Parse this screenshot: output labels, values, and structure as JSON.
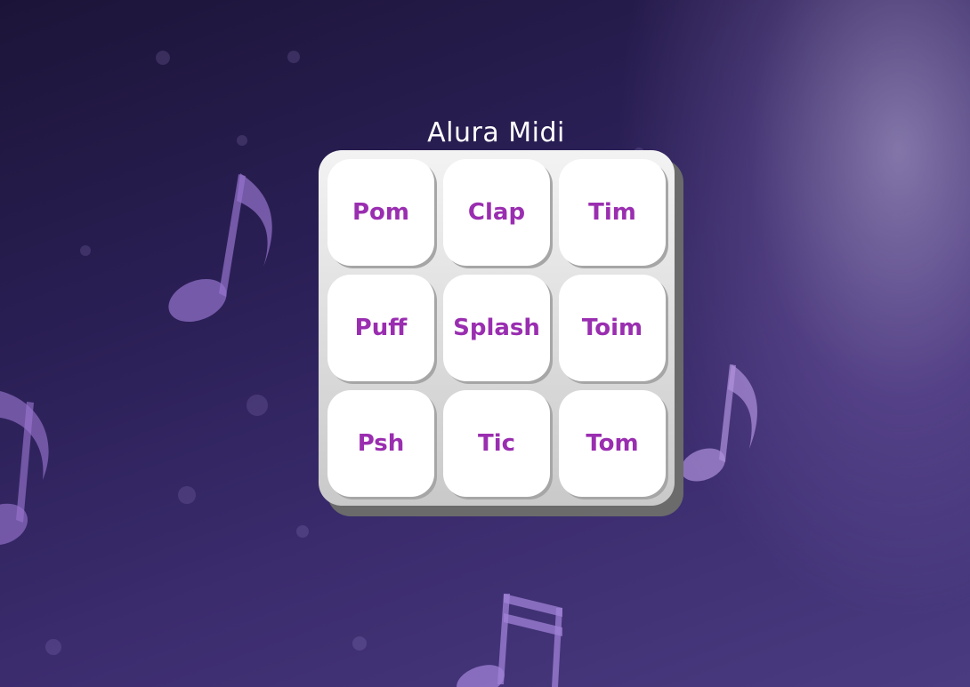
{
  "app": {
    "title": "Alura Midi"
  },
  "keypad": {
    "keys": [
      {
        "label": "Pom"
      },
      {
        "label": "Clap"
      },
      {
        "label": "Tim"
      },
      {
        "label": "Puff"
      },
      {
        "label": "Splash"
      },
      {
        "label": "Toim"
      },
      {
        "label": "Psh"
      },
      {
        "label": "Tic"
      },
      {
        "label": "Tom"
      }
    ]
  },
  "colors": {
    "key_text": "#9a2eb0",
    "key_background": "#ffffff",
    "keypad_background": "#dcdcdc",
    "keypad_shadow": "#6b6b6b",
    "title_text": "#ffffff",
    "page_background": "#2a1f55"
  },
  "background": {
    "decorations": [
      "music-note-icon",
      "stage-spotlight"
    ]
  }
}
